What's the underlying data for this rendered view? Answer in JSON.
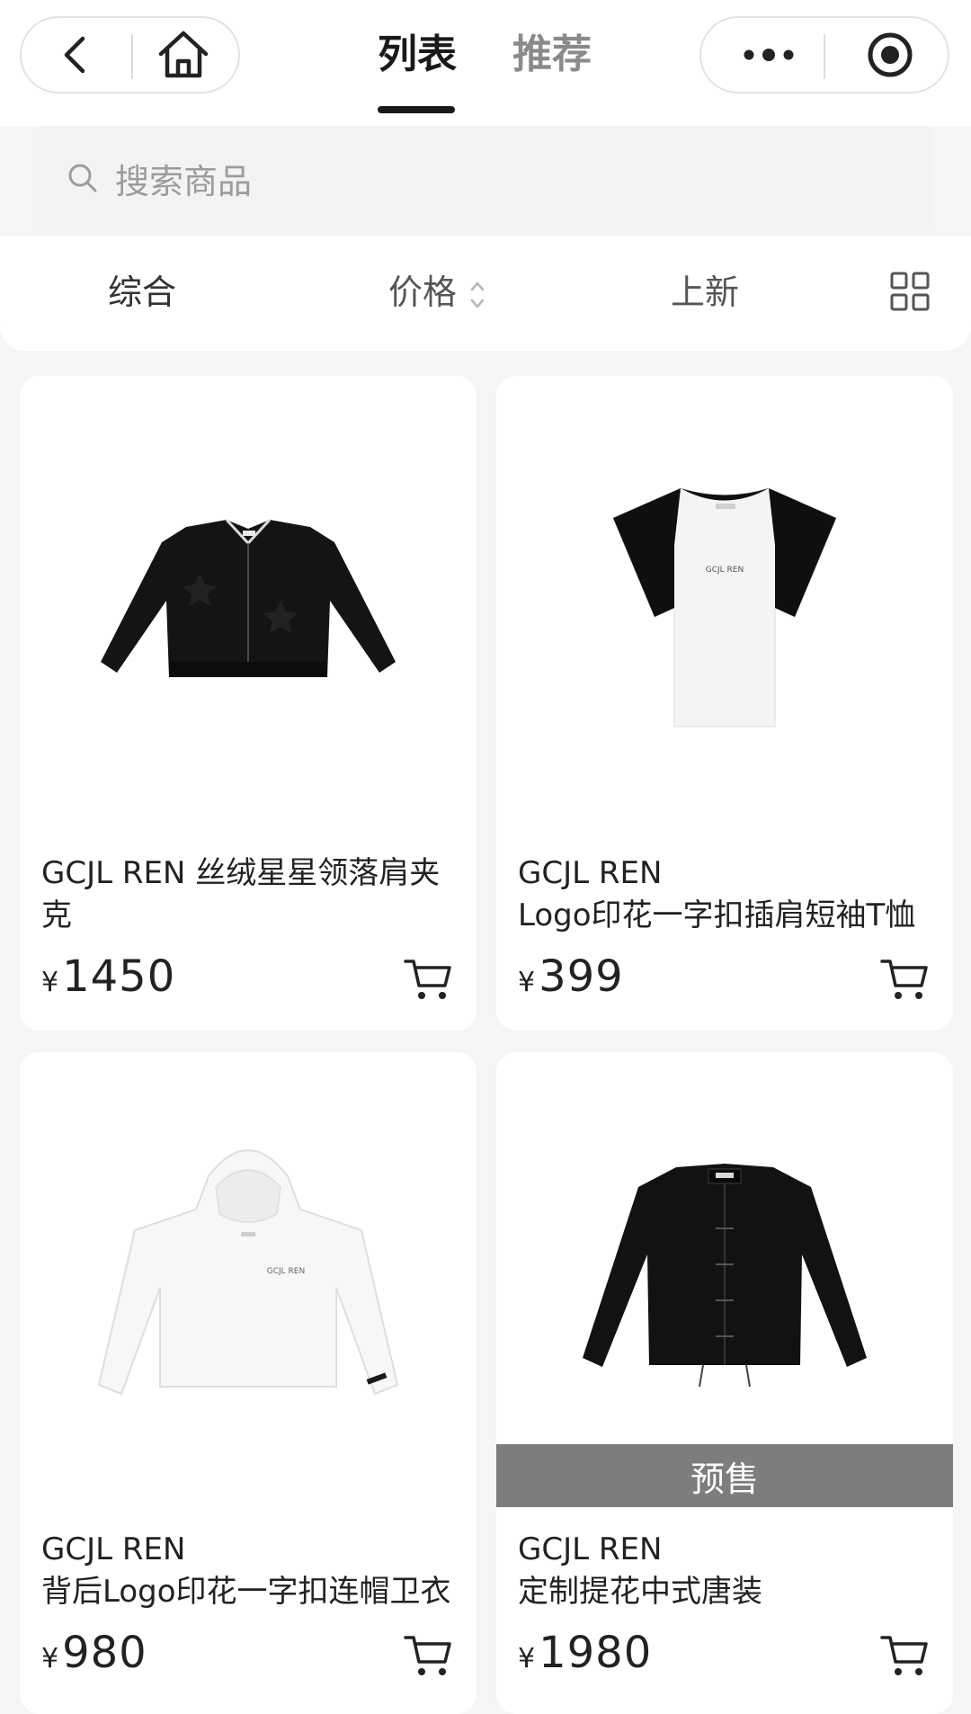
{
  "nav": {
    "tabs": [
      {
        "label": "列表",
        "active": true
      },
      {
        "label": "推荐",
        "active": false
      }
    ]
  },
  "search": {
    "placeholder": "搜索商品"
  },
  "filters": {
    "default": "综合",
    "price": "价格",
    "new": "上新"
  },
  "products": [
    {
      "title_line1": "GCJL REN 丝绒星星领落肩夹",
      "title_line2": "克",
      "currency": "¥",
      "price": "1450",
      "badge": ""
    },
    {
      "title_line1": "GCJL REN",
      "title_line2": "Logo印花一字扣插肩短袖T恤",
      "currency": "¥",
      "price": "399",
      "badge": ""
    },
    {
      "title_line1": "GCJL REN",
      "title_line2": "背后Logo印花一字扣连帽卫衣",
      "currency": "¥",
      "price": "980",
      "badge": ""
    },
    {
      "title_line1": "GCJL REN",
      "title_line2": "定制提花中式唐装",
      "currency": "¥",
      "price": "1980",
      "badge": "预售"
    }
  ],
  "colors": {
    "page_bg": "#f5f5f5",
    "card_bg": "#ffffff",
    "text_primary": "#222222",
    "text_muted": "#8a8a8a",
    "presale_bar": "#7d7d7d"
  },
  "icons": [
    "back-icon",
    "home-icon",
    "more-icon",
    "record-icon",
    "search-icon",
    "sort-icon",
    "grid-layout-icon",
    "cart-icon"
  ]
}
